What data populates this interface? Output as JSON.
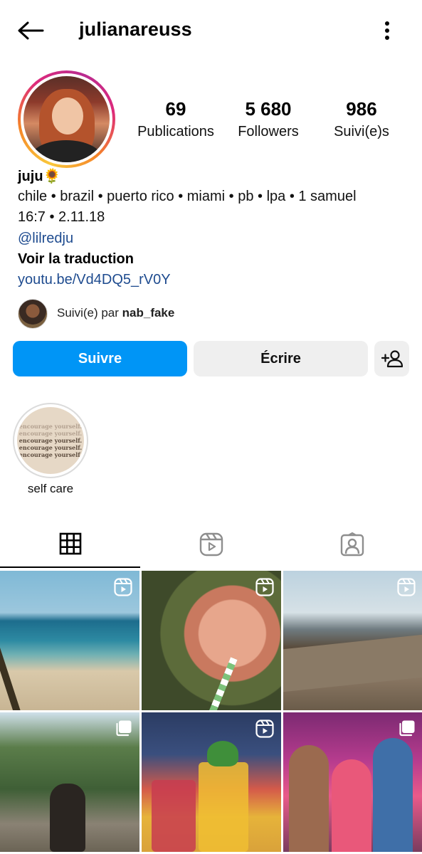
{
  "header": {
    "username": "julianareuss",
    "back_icon": "arrow-left-icon",
    "more_icon": "more-vertical-icon"
  },
  "stats": {
    "posts": {
      "value": "69",
      "label": "Publications"
    },
    "followers": {
      "value": "5 680",
      "label": "Followers"
    },
    "following": {
      "value": "986",
      "label": "Suivi(e)s"
    }
  },
  "bio": {
    "name": "juju🌻",
    "line1": "chile • brazil • puerto rico • miami • pb • lpa • 1 samuel",
    "line2": "16:7 • 2.11.18",
    "mention": "@lilredju",
    "translate": "Voir la traduction",
    "link": "youtu.be/Vd4DQ5_rV0Y"
  },
  "followed_by": {
    "prefix": "Suivi(e) par ",
    "name": "nab_fake"
  },
  "actions": {
    "follow": "Suivre",
    "message": "Écrire",
    "add_icon": "person-add-icon"
  },
  "highlights": [
    {
      "label": "self care",
      "image_text": [
        "encourage yourself.",
        "encourage yourself.",
        "encourage yourself.",
        "encourage yourself.",
        "encourage yourself."
      ]
    }
  ],
  "tabs": [
    {
      "icon": "grid-icon",
      "active": true
    },
    {
      "icon": "reels-icon",
      "active": false
    },
    {
      "icon": "tagged-icon",
      "active": false
    }
  ],
  "posts": [
    {
      "type": "reel",
      "badge_icon": "reel-icon"
    },
    {
      "type": "reel",
      "badge_icon": "reel-icon"
    },
    {
      "type": "reel",
      "badge_icon": "reel-icon"
    },
    {
      "type": "carousel",
      "badge_icon": "carousel-icon"
    },
    {
      "type": "reel",
      "badge_icon": "reel-icon"
    },
    {
      "type": "carousel",
      "badge_icon": "carousel-icon"
    }
  ],
  "colors": {
    "accent": "#0095f6",
    "link": "#1e4b8f",
    "button_secondary": "#efefef"
  }
}
